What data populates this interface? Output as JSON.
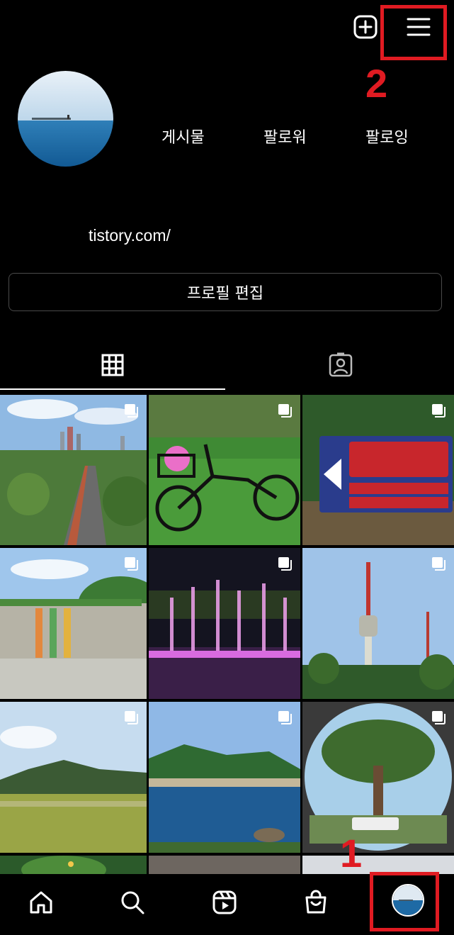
{
  "header": {
    "add_icon": "plus-square-icon",
    "menu_icon": "hamburger-menu-icon"
  },
  "profile": {
    "posts_label": "게시물",
    "followers_label": "팔로워",
    "following_label": "팔로잉",
    "link_text": "tistory.com/",
    "edit_button_label": "프로필 편집"
  },
  "tabs": [
    {
      "name": "grid",
      "icon": "grid-icon",
      "active": true
    },
    {
      "name": "tagged",
      "icon": "tagged-person-icon",
      "active": false
    }
  ],
  "posts": [
    {
      "subject": "han-river-bike-path",
      "multi": true
    },
    {
      "subject": "bicycle-with-helmet",
      "multi": true
    },
    {
      "subject": "mungyeong-omija-theme-tunnel-sign",
      "multi": true
    },
    {
      "subject": "ecoland-building",
      "multi": true
    },
    {
      "subject": "pink-fountain-night",
      "multi": true
    },
    {
      "subject": "namsan-tower",
      "multi": true
    },
    {
      "subject": "green-field-mountains",
      "multi": true
    },
    {
      "subject": "lake-and-mountains",
      "multi": true
    },
    {
      "subject": "pine-tree-through-circle",
      "multi": true
    }
  ],
  "annotations": {
    "marker_1": "1",
    "marker_2": "2",
    "color": "#e01b22"
  },
  "navbar": {
    "items": [
      "home-icon",
      "search-icon",
      "reels-icon",
      "shop-icon",
      "profile-avatar"
    ]
  }
}
